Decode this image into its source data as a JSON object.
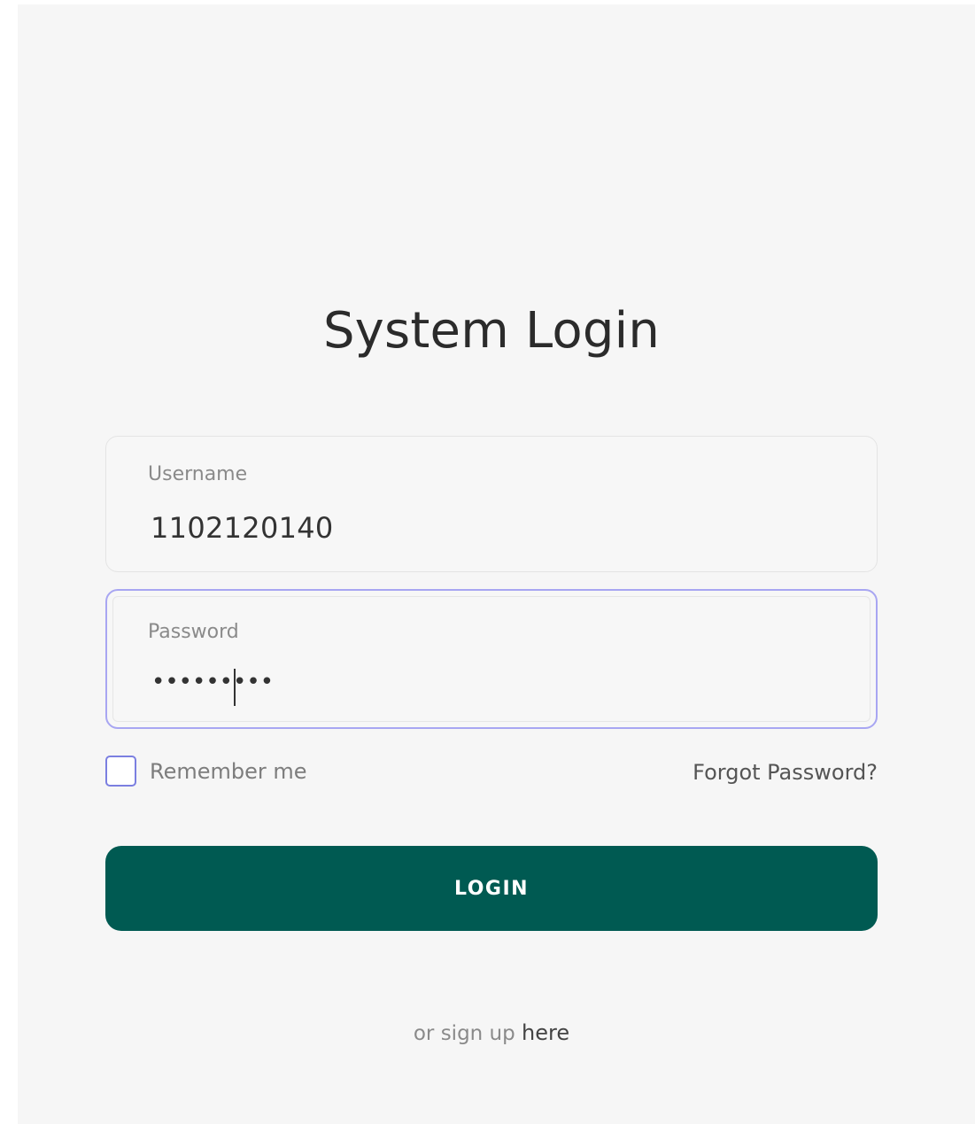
{
  "login": {
    "title": "System Login",
    "username": {
      "label": "Username",
      "value": "1102120140"
    },
    "password": {
      "label": "Password",
      "masked_value": "•••••••••"
    },
    "remember_me": {
      "label": "Remember me",
      "checked": false
    },
    "forgot_password_label": "Forgot Password?",
    "submit_label": "LOGIN",
    "signup_prefix": "or sign up ",
    "signup_link_label": "here"
  },
  "colors": {
    "panel_background": "#f6f6f6",
    "button_background": "#005a52",
    "focus_border": "#a8a6f2",
    "checkbox_border": "#7b7fe0"
  }
}
